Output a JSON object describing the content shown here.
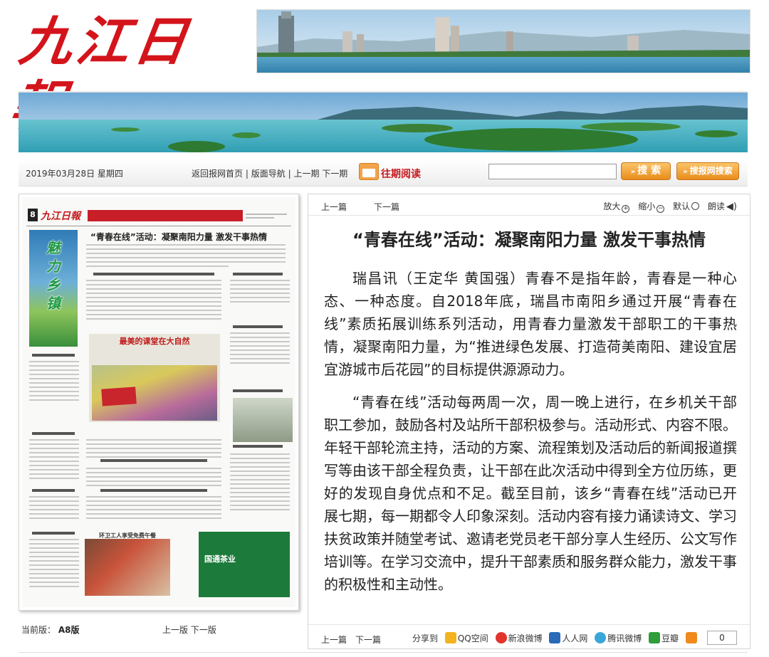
{
  "masthead": {
    "logo_text": "九江日報"
  },
  "toolbar": {
    "date": "2019年03月28日 星期四",
    "home": "返回报网首页",
    "sep": "|",
    "section_nav": "版面导航",
    "prev_issue": "上一期",
    "next_issue": "下一期",
    "past_reading": "往期阅读",
    "search_placeholder": "",
    "search_label": "搜 索",
    "site_search_label": "搜报网搜索"
  },
  "thumbnail": {
    "page_badge": "8",
    "logo": "九江日報",
    "headline": "“青春在线”活动：凝聚南阳力量 激发干事热情",
    "side_text": "魅力乡镇",
    "photo_title": "最美的课堂在大自然",
    "photo3_title": "环卫工人享受免费午餐",
    "tea_text": "国通茶业"
  },
  "footer_left": {
    "current_label": "当前版：",
    "current_value": "A8版",
    "prev_page": "上一版",
    "next_page": "下一版"
  },
  "article": {
    "prev": "上一篇",
    "next": "下一篇",
    "zoom_in": "放大",
    "zoom_out": "缩小",
    "default": "默认",
    "read_aloud": "朗读",
    "title": "“青春在线”活动：凝聚南阳力量 激发干事热情",
    "paragraphs": [
      "瑞昌讯（王定华 黄国强）青春不是指年龄，青春是一种心态、一种态度。自2018年底，瑞昌市南阳乡通过开展“青春在线”素质拓展训练系列活动，用青春力量激发干部职工的干事热情，凝聚南阳力量，为“推进绿色发展、打造荷美南阳、建设宜居宜游城市后花园”的目标提供源源动力。",
      "“青春在线”活动每两周一次，周一晚上进行，在乡机关干部职工参加，鼓励各村及站所干部积极参与。活动形式、内容不限。年轻干部轮流主持，活动的方案、流程策划及活动后的新闻报道撰写等由该干部全程负责，让干部在此次活动中得到全方位历练，更好的发现自身优点和不足。截至目前，该乡“青春在线”活动已开展七期，每一期都令人印象深刻。活动内容有接力诵读诗文、学习扶贫政策并随堂考试、邀请老党员老干部分享人生经历、公文写作培训等。在学习交流中，提升干部素质和服务群众能力，激发干事的积极性和主动性。"
    ],
    "bottom_prev": "上一篇",
    "bottom_next": "下一篇",
    "share_label": "分享到",
    "share_qzone": "QQ空间",
    "share_sina": "新浪微博",
    "share_renren": "人人网",
    "share_tencent": "腾讯微博",
    "share_douban": "豆瓣",
    "share_count": "0"
  },
  "colors": {
    "brand_red": "#d4141b",
    "button_orange": "#e98c1a"
  }
}
